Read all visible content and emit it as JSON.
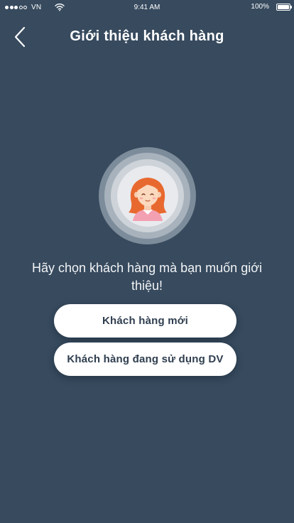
{
  "status_bar": {
    "carrier": "VN",
    "time": "9:41 AM",
    "battery_percent": "100%",
    "signal_strength": 3,
    "signal_max": 5,
    "battery_level": 1.0
  },
  "header": {
    "title": "Giới thiệu khách hàng",
    "back_icon": "chevron-left-icon"
  },
  "main": {
    "avatar_icon": "female-customer-avatar-icon",
    "prompt_text": "Hãy chọn khách hàng mà bạn muốn giới thiệu!",
    "buttons": [
      {
        "label": "Khách hàng mới"
      },
      {
        "label": "Khách hàng đang sử dụng DV"
      }
    ]
  },
  "colors": {
    "background": "#374a5e",
    "button_background": "#ffffff",
    "button_text": "#2f3e4f",
    "avatar_hair": "#e8692f",
    "avatar_shirt": "#f3a0b2"
  }
}
